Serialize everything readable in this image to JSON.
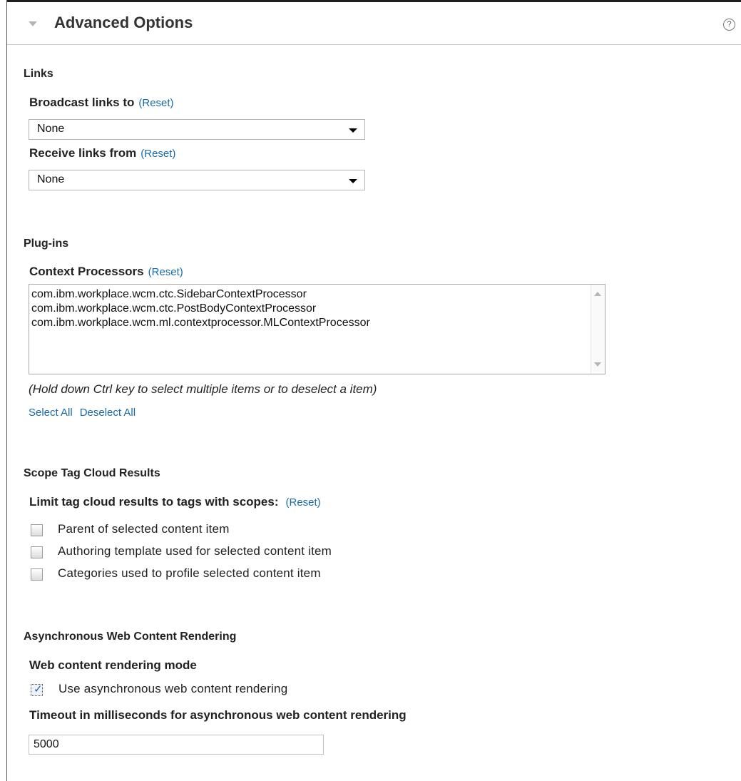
{
  "panel": {
    "title": "Advanced Options",
    "help_icon": "help-icon"
  },
  "links": {
    "heading": "Links",
    "broadcast": {
      "label": "Broadcast links to",
      "reset": "(Reset)",
      "value": "None"
    },
    "receive": {
      "label": "Receive links from",
      "reset": "(Reset)",
      "value": "None"
    }
  },
  "plugins": {
    "heading": "Plug-ins",
    "context_processors": {
      "label": "Context Processors",
      "reset": "(Reset)",
      "items": [
        "com.ibm.workplace.wcm.ctc.SidebarContextProcessor",
        "com.ibm.workplace.wcm.ctc.PostBodyContextProcessor",
        "com.ibm.workplace.wcm.ml.contextprocessor.MLContextProcessor"
      ]
    },
    "hint": "(Hold down Ctrl key to select multiple items or to deselect a item)",
    "select_all": "Select All",
    "deselect_all": "Deselect All"
  },
  "scope": {
    "heading": "Scope Tag Cloud Results",
    "label": "Limit tag cloud results to tags with scopes:",
    "reset": "(Reset)",
    "options": [
      {
        "label": "Parent of selected content item",
        "checked": false
      },
      {
        "label": "Authoring template used for selected content item",
        "checked": false
      },
      {
        "label": "Categories used to profile selected content item",
        "checked": false
      }
    ]
  },
  "async": {
    "heading": "Asynchronous Web Content Rendering",
    "mode_label": "Web content rendering mode",
    "use_async": {
      "label": "Use asynchronous web content rendering",
      "checked": true
    },
    "timeout_label": "Timeout in milliseconds for asynchronous web content rendering",
    "timeout_value": "5000"
  }
}
